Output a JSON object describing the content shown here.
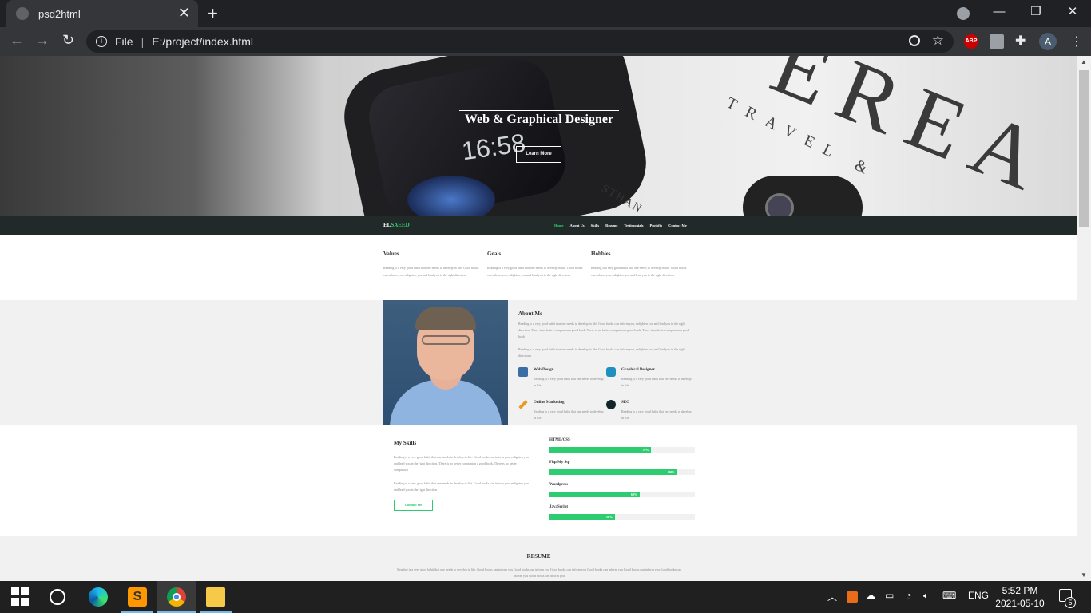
{
  "browser": {
    "tab_title": "psd2html",
    "new_tab": "+",
    "close_tab": "✕",
    "scheme_label": "File",
    "url": "E:/project/index.html",
    "avatar_letter": "A",
    "abp_label": "ABP"
  },
  "hero": {
    "clock_text": "16:58",
    "photo_text_big": "EREA",
    "photo_text_travel": "TRAVEL &",
    "photo_text_sthan": "STHAN",
    "title": "Web & Graphical Designer",
    "button": "Learn More"
  },
  "navbar": {
    "logo_prefix": "EL",
    "logo_highlight": "SAEED",
    "items": [
      {
        "label": "Home",
        "active": true
      },
      {
        "label": "About Us",
        "active": false
      },
      {
        "label": "Skills",
        "active": false
      },
      {
        "label": "Resume",
        "active": false
      },
      {
        "label": "Testimonials",
        "active": false
      },
      {
        "label": "Protofio",
        "active": false
      },
      {
        "label": "Contact Me",
        "active": false
      }
    ]
  },
  "values": [
    {
      "title": "Values",
      "text": "Reading is a very good habit that one needs to develop in life. Good books can inform you, enlighten you and lead you in the right direction."
    },
    {
      "title": "Goals",
      "text": "Reading is a very good habit that one needs to develop in life. Good books can inform you, enlighten you and lead you in the right direction."
    },
    {
      "title": "Hobbies",
      "text": "Reading is a very good habit that one needs to develop in life. Good books can inform you, enlighten you and lead you in the right direction."
    }
  ],
  "about": {
    "title": "About Me",
    "p1": "Reading is a very good habit that one needs to develop in life. Good books can inform you, enlighten you and lead you in the right direction. There is no better companion a good book. There is no better companion a good book. There is no better companion a good book",
    "p2": "Reading is a very good habit that one needs to develop in life. Good books can inform you, enlighten you and lead you in the right directionk",
    "services": [
      {
        "title": "Web Design",
        "text": "Reading is a very good habit that one needs to develop in life",
        "icon": "web-design-icon",
        "color": "#3b6ea5"
      },
      {
        "title": "Graphical Designer",
        "text": "Reading is a very good habit that one needs to develop in life",
        "icon": "graphic-design-icon",
        "color": "#1f8fbf"
      },
      {
        "title": "Online Marketing",
        "text": "Reading is a very good habit that one needs to develop in life",
        "icon": "pencil-icon",
        "color": "#e89a23"
      },
      {
        "title": "SEO",
        "text": "Reading is a very good habit that one needs to develop in life",
        "icon": "seo-icon",
        "color": "#10262a"
      }
    ]
  },
  "skills": {
    "title": "My Skills",
    "p1": "Reading is a very good habit that one needs to develop in life. Good books can inform you, enlighten you and lead you in the right direction. There is no better companion a good book. There is no better companion",
    "p2": "Reading is a very good habit that one needs to develop in life. Good books can inform you, enlighten you and lead you in the right direction",
    "button": "Contact Me",
    "bars": [
      {
        "label": "HTML/CSS",
        "percent": 70,
        "text": "70%"
      },
      {
        "label": "Php/My Sql",
        "percent": 88,
        "text": "90%"
      },
      {
        "label": "Wordpress",
        "percent": 62,
        "text": "60%"
      },
      {
        "label": "JavaScript",
        "percent": 45,
        "text": "50%"
      }
    ]
  },
  "resume": {
    "title": "RESUME",
    "text": "Reading is a very good habit that one needs to develop in life. Good books can inform you Good books can inform you Good books can inform you Good books can inform you Good books can inform you Good books can inform you Good books can inform you"
  },
  "taskbar": {
    "time": "5:52 PM",
    "date": "2021-05-10",
    "language": "ENG",
    "notifications": "5"
  },
  "colors": {
    "accent": "#2ecc71",
    "navbar": "#222a29"
  }
}
